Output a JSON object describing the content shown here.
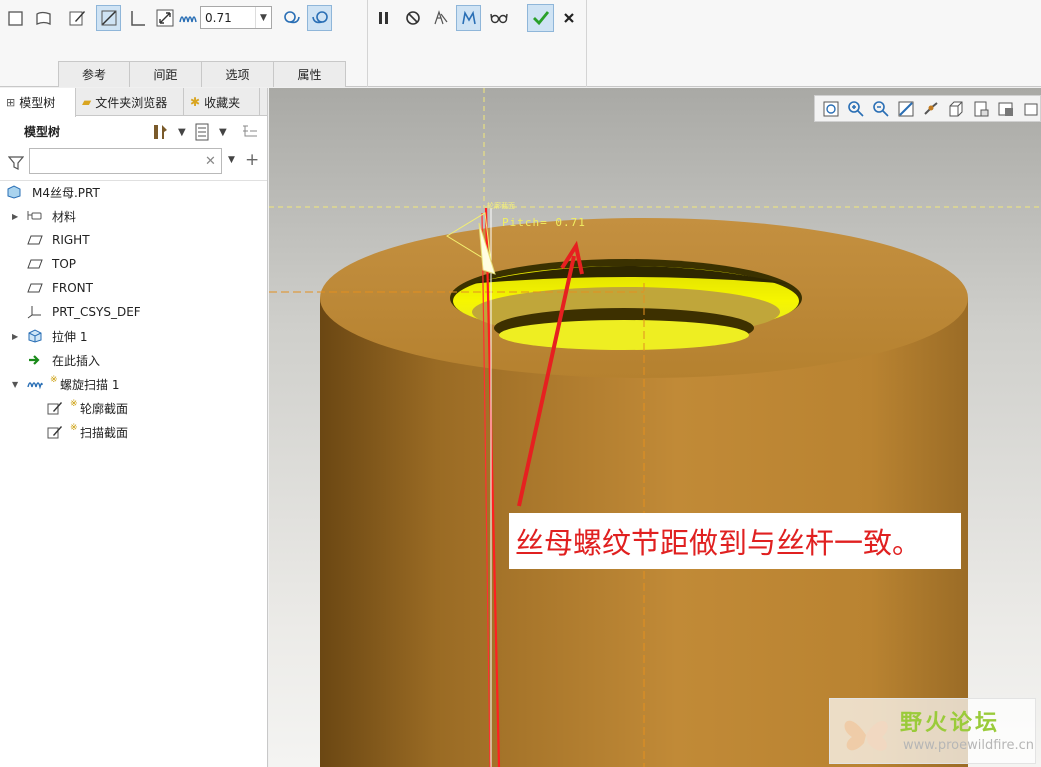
{
  "dashboard": {
    "pitch_value": "0.71",
    "tabs": [
      "参考",
      "间距",
      "选项",
      "属性"
    ]
  },
  "navigator": {
    "tabs": [
      "模型树",
      "文件夹浏览器",
      "收藏夹"
    ],
    "tree_title": "模型树",
    "search": {
      "value": ""
    },
    "tree": [
      {
        "label": "M4丝母.PRT",
        "icon": "part-icon",
        "expandable": false,
        "level": 0,
        "star": false
      },
      {
        "label": "材料",
        "icon": "material-icon",
        "expandable": true,
        "level": 1,
        "star": false
      },
      {
        "label": "RIGHT",
        "icon": "datum-plane-icon",
        "expandable": false,
        "level": 1,
        "star": false
      },
      {
        "label": "TOP",
        "icon": "datum-plane-icon",
        "expandable": false,
        "level": 1,
        "star": false
      },
      {
        "label": "FRONT",
        "icon": "datum-plane-icon",
        "expandable": false,
        "level": 1,
        "star": false
      },
      {
        "label": "PRT_CSYS_DEF",
        "icon": "csys-icon",
        "expandable": false,
        "level": 1,
        "star": false
      },
      {
        "label": "拉伸 1",
        "icon": "extrude-icon",
        "expandable": true,
        "level": 1,
        "star": false
      },
      {
        "label": "在此插入",
        "icon": "insert-here-arrow-icon",
        "expandable": false,
        "level": 1,
        "star": false
      },
      {
        "label": "螺旋扫描 1",
        "icon": "helical-sweep-icon",
        "expandable": true,
        "expanded": true,
        "level": 1,
        "star": true
      },
      {
        "label": "轮廓截面",
        "icon": "sketch-icon",
        "expandable": false,
        "level": 2,
        "star": true
      },
      {
        "label": "扫描截面",
        "icon": "sketch-icon",
        "expandable": false,
        "level": 2,
        "star": true
      }
    ]
  },
  "graphics": {
    "pitch_label": "Pitch= 0.71",
    "sweep_tag": "轮廓截面",
    "annotation": "丝母螺纹节距做到与丝杆一致。",
    "watermark_title": "野火论坛",
    "watermark_url": "www.proewildfire.cn"
  },
  "colors": {
    "part_body": "#b8822e",
    "thread_highlight": "#f2f000",
    "annotation_red": "#e02020",
    "accept_green": "#2aa02a"
  }
}
